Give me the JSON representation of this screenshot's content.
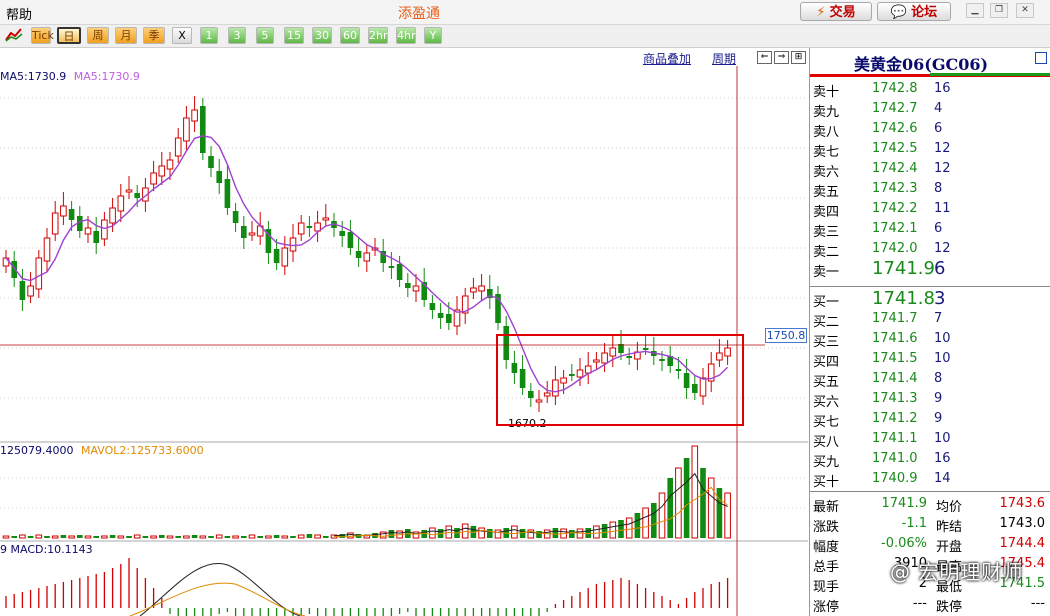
{
  "menubar": {
    "help_label": "帮助",
    "app_title": "添盈通",
    "trade_label": "交易",
    "forum_label": "论坛"
  },
  "toolbar": {
    "buttons": [
      "Tick",
      "日",
      "周",
      "月",
      "季",
      "X",
      "1",
      "3",
      "5",
      "15",
      "30",
      "60",
      "2hr",
      "4hr",
      "Y"
    ],
    "selected": "日"
  },
  "chart_header": {
    "overlay_link": "商品叠加",
    "period_link": "周期"
  },
  "indicators": {
    "ma_label": "MA5:1730.9",
    "ma_label2": "MA5:1730.9",
    "vol_label": "125079.4000",
    "vol_label2": "MAVOL2:125733.6000",
    "macd_label": "9 MACD:10.1143"
  },
  "price_tag": "1750.8",
  "low_label": "1670.2",
  "colors": {
    "up": "#d00000",
    "down": "#118a11",
    "ma": "#a040d0",
    "crosshair": "#b00000",
    "highlight": "#e00000"
  },
  "panel": {
    "title": "美黄金06(GC06)",
    "asks": [
      {
        "label": "卖十",
        "price": "1742.8",
        "qty": "16"
      },
      {
        "label": "卖九",
        "price": "1742.7",
        "qty": "4"
      },
      {
        "label": "卖八",
        "price": "1742.6",
        "qty": "6"
      },
      {
        "label": "卖七",
        "price": "1742.5",
        "qty": "12"
      },
      {
        "label": "卖六",
        "price": "1742.4",
        "qty": "12"
      },
      {
        "label": "卖五",
        "price": "1742.3",
        "qty": "8"
      },
      {
        "label": "卖四",
        "price": "1742.2",
        "qty": "11"
      },
      {
        "label": "卖三",
        "price": "1742.1",
        "qty": "6"
      },
      {
        "label": "卖二",
        "price": "1742.0",
        "qty": "12"
      },
      {
        "label": "卖一",
        "price": "1741.9",
        "qty": "6"
      }
    ],
    "bids": [
      {
        "label": "买一",
        "price": "1741.8",
        "qty": "3"
      },
      {
        "label": "买二",
        "price": "1741.7",
        "qty": "7"
      },
      {
        "label": "买三",
        "price": "1741.6",
        "qty": "10"
      },
      {
        "label": "买四",
        "price": "1741.5",
        "qty": "10"
      },
      {
        "label": "买五",
        "price": "1741.4",
        "qty": "8"
      },
      {
        "label": "买六",
        "price": "1741.3",
        "qty": "9"
      },
      {
        "label": "买七",
        "price": "1741.2",
        "qty": "9"
      },
      {
        "label": "买八",
        "price": "1741.1",
        "qty": "10"
      },
      {
        "label": "买九",
        "price": "1741.0",
        "qty": "16"
      },
      {
        "label": "买十",
        "price": "1740.9",
        "qty": "14"
      }
    ],
    "stats": [
      {
        "l1": "最新",
        "v1": "1741.9",
        "l2": "均价",
        "v2": "1743.6"
      },
      {
        "l1": "涨跌",
        "v1": "-1.1",
        "l2": "昨结",
        "v2": "1743.0"
      },
      {
        "l1": "幅度",
        "v1": "-0.06%",
        "l2": "开盘",
        "v2": "1744.4"
      },
      {
        "l1": "总手",
        "v1": "3910",
        "l2": "最高",
        "v2": "1745.4"
      },
      {
        "l1": "现手",
        "v1": "2",
        "l2": "最低",
        "v2": "1741.5"
      },
      {
        "l1": "涨停",
        "v1": "---",
        "l2": "跌停",
        "v2": "---"
      }
    ]
  },
  "watermark": "@ 宏明理财师"
}
